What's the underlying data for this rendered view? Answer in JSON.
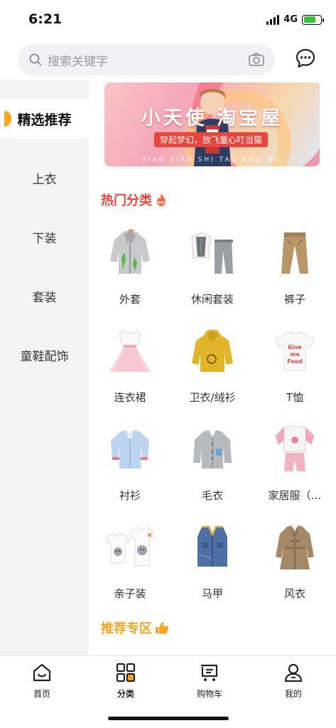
{
  "status_bar": {
    "time": "6:21",
    "network": "4G",
    "battery_level": 0.7,
    "battery_color": "#3cc23c"
  },
  "search": {
    "placeholder": "搜索关键字",
    "icons": [
      "search-icon",
      "camera-icon",
      "message-icon"
    ]
  },
  "sidebar": {
    "accent": "#f5a623",
    "items": [
      {
        "label": "精选推荐",
        "active": true
      },
      {
        "label": "上衣",
        "active": false
      },
      {
        "label": "下装",
        "active": false
      },
      {
        "label": "套装",
        "active": false
      },
      {
        "label": "童鞋配饰",
        "active": false
      }
    ]
  },
  "banner": {
    "title": "小天使 淘宝屋",
    "tagline": "穿起梦幻，放飞童心叮当猫",
    "subtitle": "XIAO TIAN SHI TAO BAO WU"
  },
  "hot_section": {
    "title": "热门分类",
    "badge": "HOT",
    "color": "#e8453c",
    "categories": [
      {
        "label": "外套",
        "icon": "hoodie-jacket-image"
      },
      {
        "label": "休闲套装",
        "icon": "casual-set-image"
      },
      {
        "label": "裤子",
        "icon": "pants-image"
      },
      {
        "label": "连衣裙",
        "icon": "dress-image"
      },
      {
        "label": "卫衣/绒衫",
        "icon": "sweatshirt-image"
      },
      {
        "label": "T恤",
        "icon": "tshirt-image"
      },
      {
        "label": "衬衫",
        "icon": "shirt-image"
      },
      {
        "label": "毛衣",
        "icon": "sweater-image"
      },
      {
        "label": "家居服（…",
        "icon": "homewear-image"
      },
      {
        "label": "亲子装",
        "icon": "family-outfit-image"
      },
      {
        "label": "马甲",
        "icon": "vest-image"
      },
      {
        "label": "风衣",
        "icon": "trench-coat-image"
      }
    ]
  },
  "recommend_section": {
    "title": "推荐专区",
    "color": "#f5a623"
  },
  "tabbar": {
    "items": [
      {
        "label": "首页",
        "icon": "home-icon",
        "active": false
      },
      {
        "label": "分类",
        "icon": "category-icon",
        "active": true
      },
      {
        "label": "购物车",
        "icon": "cart-icon",
        "active": false
      },
      {
        "label": "我的",
        "icon": "profile-icon",
        "active": false
      }
    ]
  }
}
